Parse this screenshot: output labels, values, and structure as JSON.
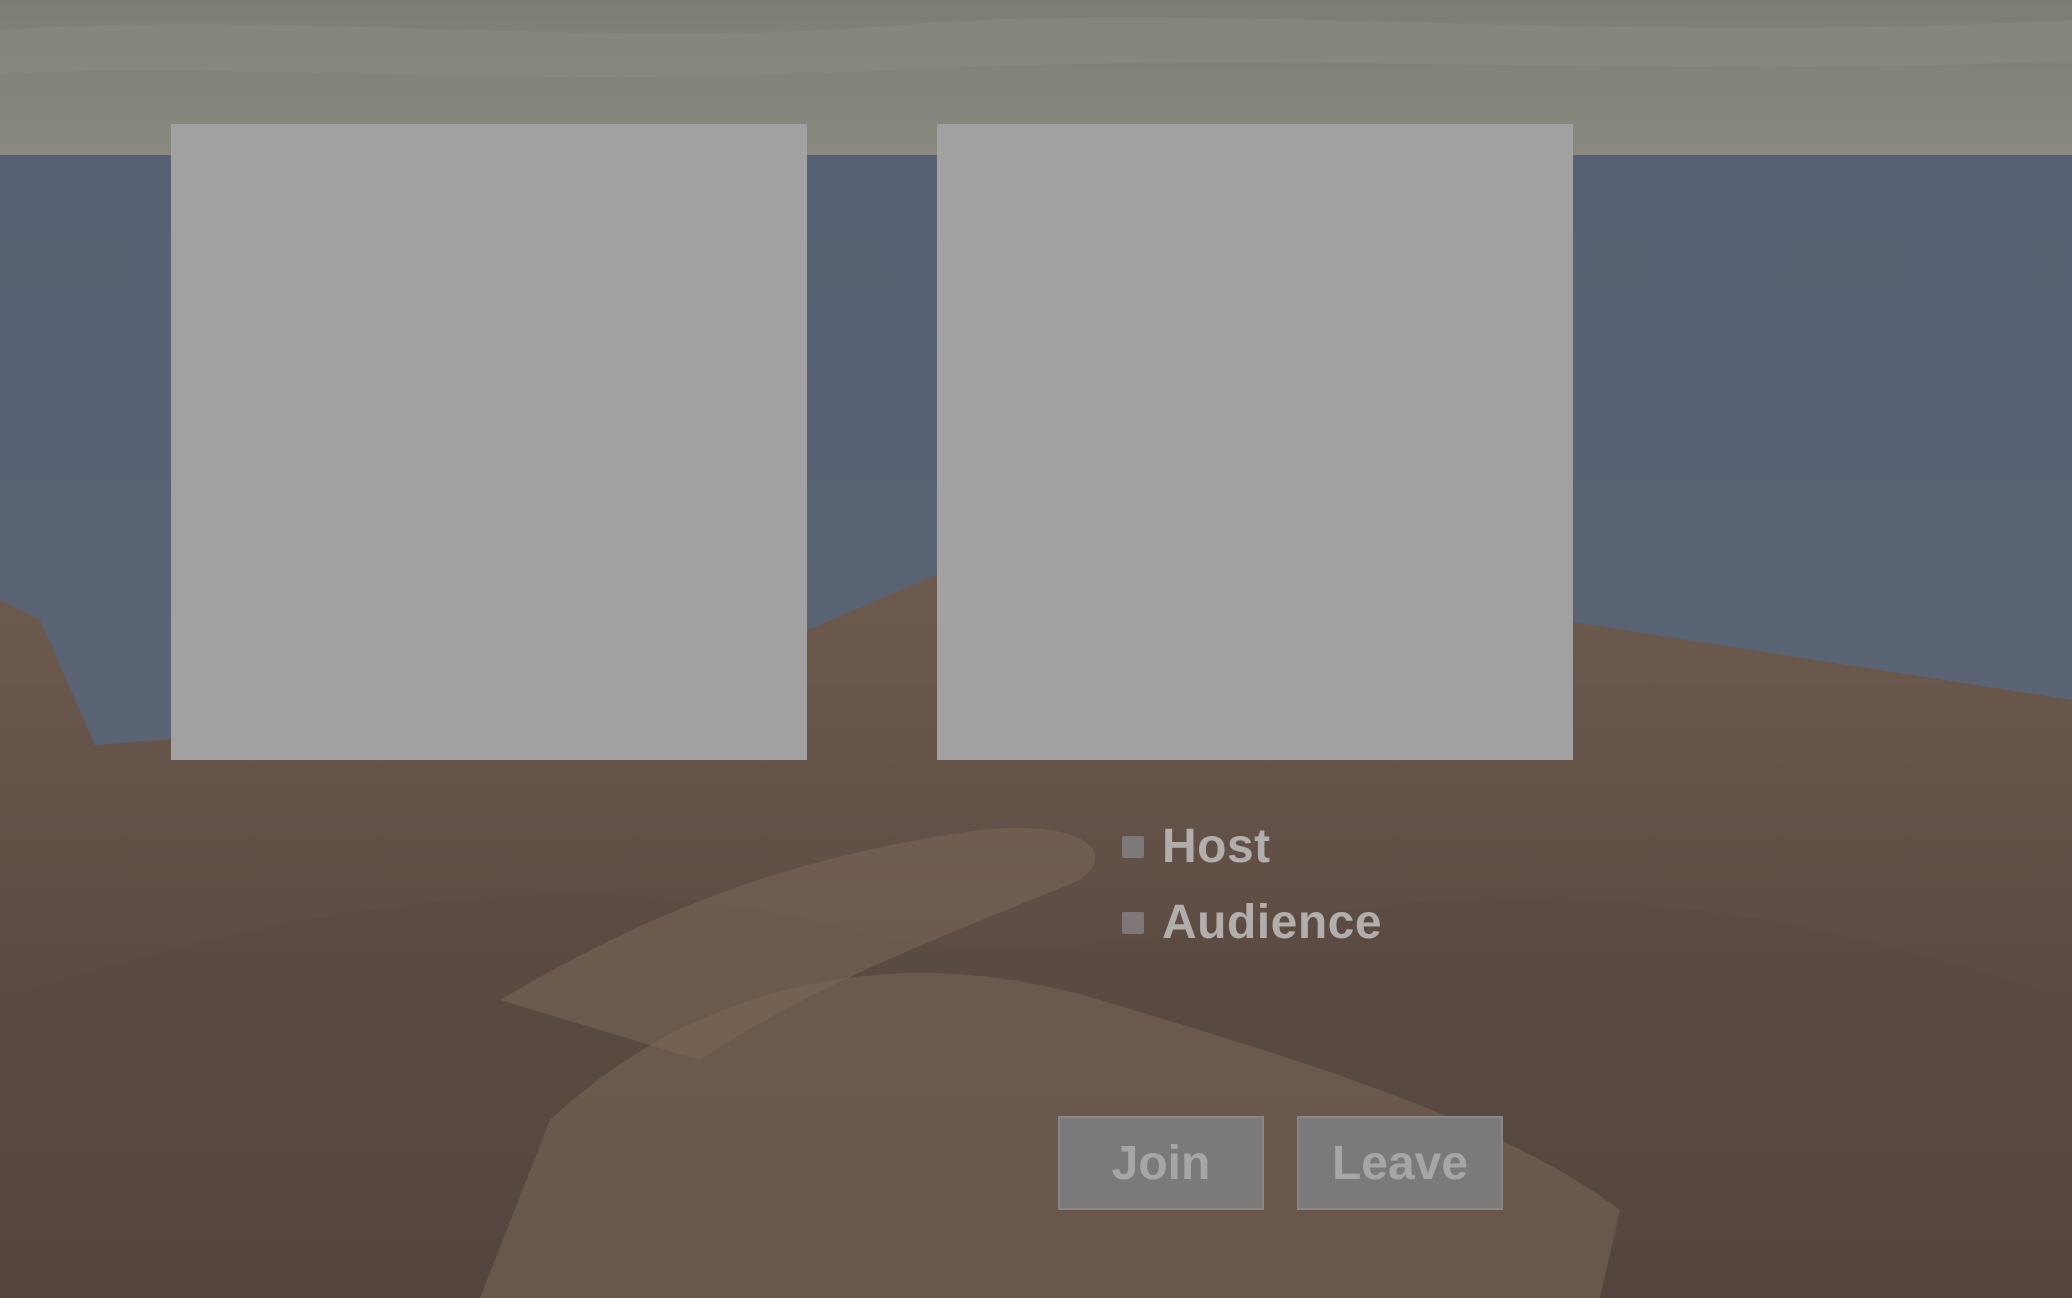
{
  "roles": {
    "host_label": "Host",
    "audience_label": "Audience"
  },
  "actions": {
    "join_label": "Join",
    "leave_label": "Leave"
  },
  "colors": {
    "panel": "#a1a1a1",
    "button": "#7b7979",
    "button_text": "#a8a6a5",
    "label_text": "#b2aeac",
    "checkbox": "#7d7877"
  }
}
